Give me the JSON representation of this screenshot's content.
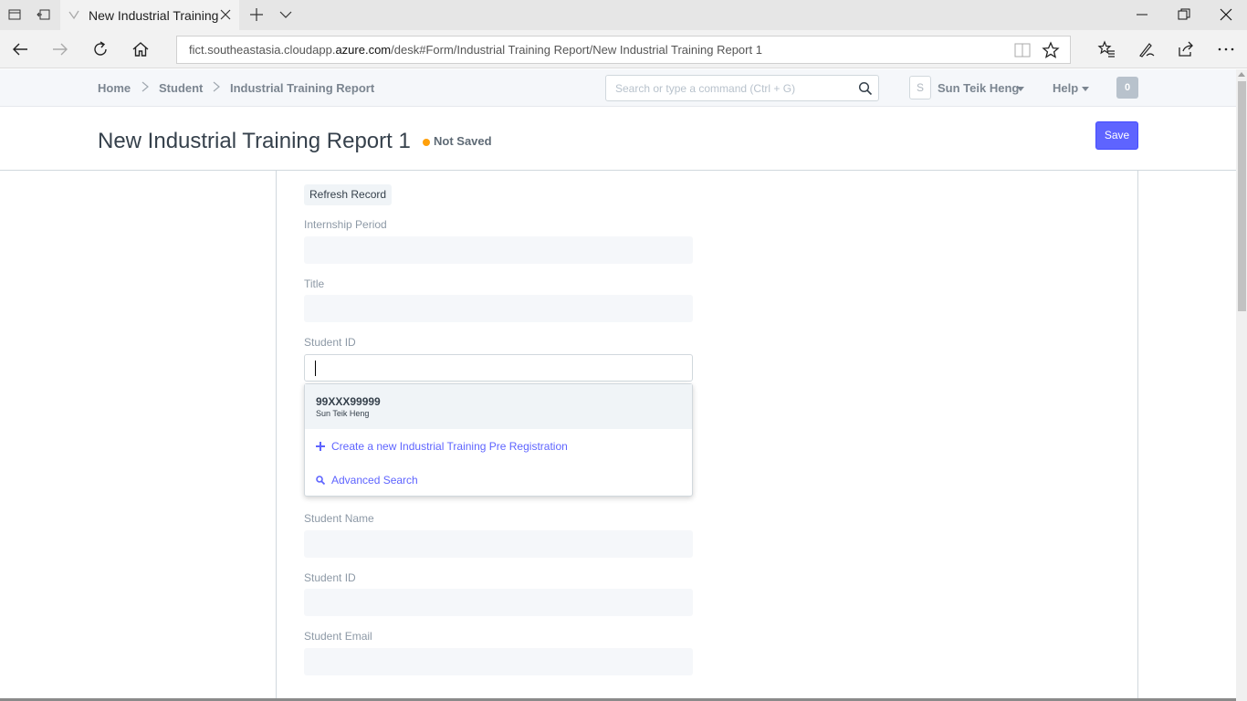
{
  "browser": {
    "tab_title": "New Industrial Training",
    "url_prefix": "fict.southeastasia.cloudapp.",
    "url_domain": "azure.com",
    "url_suffix": "/desk#Form/Industrial Training Report/New Industrial Training Report 1"
  },
  "header": {
    "breadcrumbs": [
      "Home",
      "Student",
      "Industrial Training Report"
    ],
    "search_placeholder": "Search or type a command (Ctrl + G)",
    "avatar_initial": "S",
    "user_name": "Sun Teik Heng",
    "help_label": "Help",
    "notification_count": "0"
  },
  "page": {
    "title": "New Industrial Training Report 1",
    "status": "Not Saved",
    "status_color": "#ffa00a",
    "save_label": "Save",
    "accent_color": "#5e64ff"
  },
  "form": {
    "refresh_label": "Refresh Record",
    "fields": [
      {
        "label": "Internship Period",
        "value": ""
      },
      {
        "label": "Title",
        "value": ""
      },
      {
        "label": "Student ID",
        "value": ""
      },
      {
        "label": "Student Name",
        "value": ""
      },
      {
        "label": "Student ID",
        "value": ""
      },
      {
        "label": "Student Email",
        "value": ""
      }
    ]
  },
  "dropdown": {
    "result_id": "99XXX99999",
    "result_name": "Sun Teik Heng",
    "create_label": "Create a new Industrial Training Pre Registration",
    "advanced_label": "Advanced Search"
  }
}
